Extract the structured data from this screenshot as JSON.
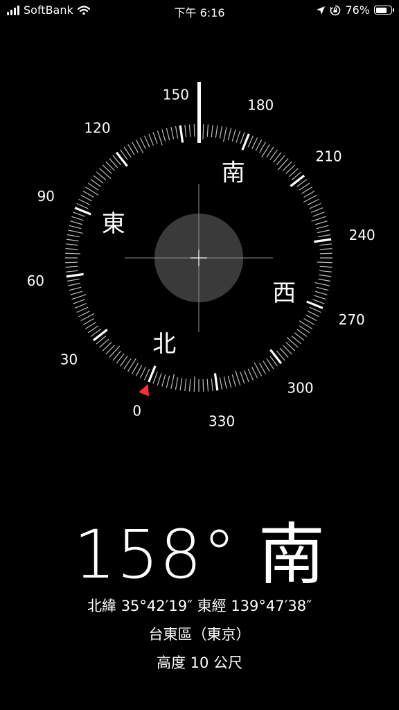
{
  "status_bar": {
    "carrier": "SoftBank",
    "time": "下午 6:16",
    "battery_percent": "76%",
    "battery_level": 0.76,
    "icons": [
      "signal-icon",
      "wifi-icon",
      "location-arrow-icon",
      "orientation-lock-icon",
      "battery-icon"
    ]
  },
  "compass": {
    "heading_degrees": 158,
    "target_marker_bearing": 0,
    "degree_labels": [
      "0",
      "30",
      "60",
      "90",
      "120",
      "150",
      "180",
      "210",
      "240",
      "270",
      "300",
      "330"
    ],
    "cardinals": {
      "north": "北",
      "east": "東",
      "south": "南",
      "west": "西"
    },
    "colors": {
      "background": "#000000",
      "ticks": "#ffffff",
      "marker": "#ff2d2d",
      "level": "#3a3a3a"
    }
  },
  "readout": {
    "heading": "158° 南",
    "coordinates": "北緯 35°42′19″  東經 139°47′38″",
    "location": "台東區（東京）",
    "altitude": "高度 10 公尺"
  }
}
